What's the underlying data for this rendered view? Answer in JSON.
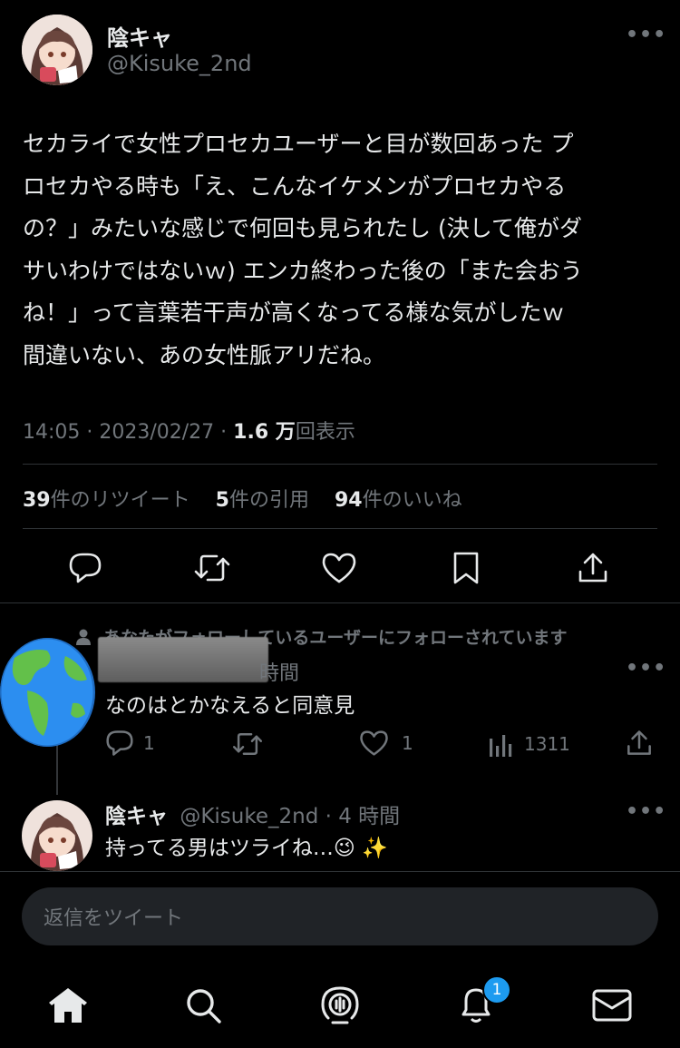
{
  "main_tweet": {
    "display_name": "陰キャ",
    "handle": "@Kisuke_2nd",
    "text_lines": [
      "セカライで女性プロセカユーザーと目が数回あった プ",
      "ロセカやる時も「え、こんなイケメンがプロセカやる",
      "の？」みたいな感じで何回も見られたし (決して俺がダ",
      "サいわけではないｗ) エンカ終わった後の「また会おう",
      "ね！」って言葉若干声が高くなってる様な気がしたｗ",
      "間違いない、あの女性脈アリだね。"
    ],
    "time": "14:05 · 2023/02/27 · ",
    "views_count": "1.6 万",
    "views_label": "回表示",
    "retweets_count": "39",
    "retweets_label": "件のリツイート",
    "quotes_count": "5",
    "quotes_label": "件の引用",
    "likes_count": "94",
    "likes_label": "件のいいね",
    "more": "•••"
  },
  "reply1": {
    "social_context": "あなたがフォローしているユーザーにフォローされています",
    "time_suffix": "時間",
    "text": "なのはとかなえると同意見",
    "replies": "1",
    "likes": "1",
    "views": "1311",
    "more": "•••"
  },
  "reply2": {
    "display_name": "陰キャ",
    "handle_time": "@Kisuke_2nd · 4 時間",
    "text": "持ってる男はツライね…😉 ✨",
    "more": "•••"
  },
  "compose": {
    "placeholder": "返信をツイート"
  },
  "bottom_nav": {
    "notifications_badge": "1"
  },
  "colors": {
    "background": "#000000",
    "text": "#e7e9ea",
    "muted": "#71767b",
    "badge": "#1d9bf0",
    "divider": "#2f3336"
  }
}
